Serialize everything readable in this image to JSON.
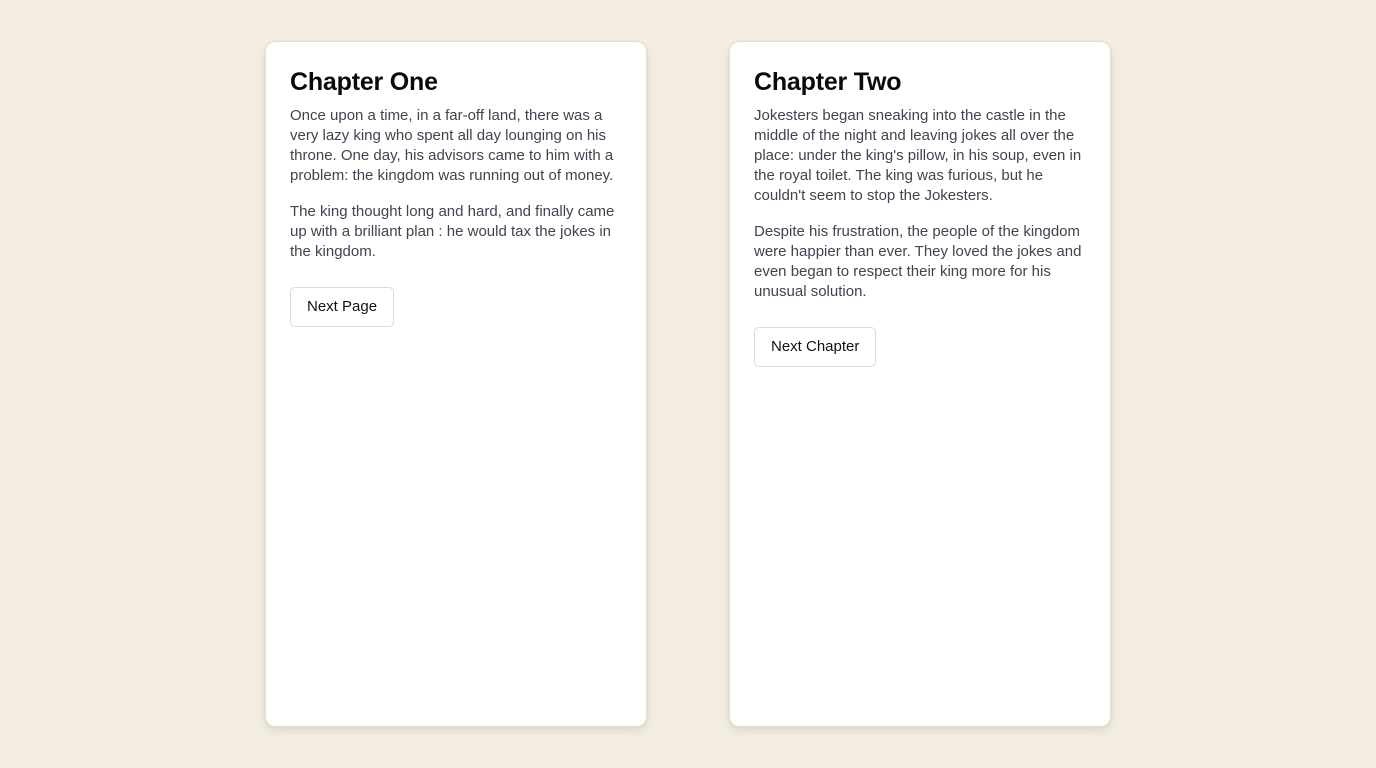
{
  "chapters": [
    {
      "title": "Chapter One",
      "paragraphs": [
        "Once upon a time, in a far-off land, there was a very lazy king who spent all day lounging on his throne. One day, his advisors came to him with a problem: the kingdom was running out of money.",
        "The king thought long and hard, and finally came up with a brilliant plan : he would tax the jokes in the kingdom."
      ],
      "button_label": "Next Page"
    },
    {
      "title": "Chapter Two",
      "paragraphs": [
        "Jokesters began sneaking into the castle in the middle of the night and leaving jokes all over the place: under the king's pillow, in his soup, even in the royal toilet. The king was furious, but he couldn't seem to stop the Jokesters.",
        "Despite his frustration, the people of the kingdom were happier than ever. They loved the jokes and even began to respect their king more for his unusual solution."
      ],
      "button_label": "Next Chapter"
    }
  ],
  "colors": {
    "background": "#f3eee0",
    "card": "#ffffff",
    "heading": "#0a0a0a",
    "body_text": "#3f4450",
    "border": "#dedbd3"
  }
}
